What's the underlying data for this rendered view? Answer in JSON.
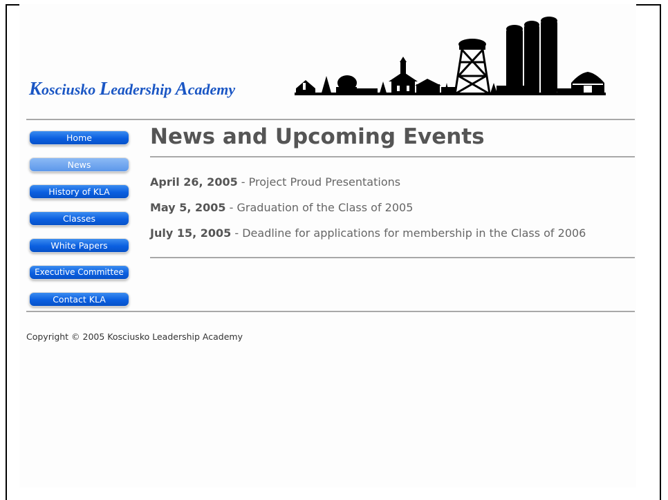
{
  "site": {
    "title_letters": [
      {
        "cap": "K",
        "rest": "osciusko "
      },
      {
        "cap": "L",
        "rest": "eadership "
      },
      {
        "cap": "A",
        "rest": "cademy"
      }
    ]
  },
  "nav": {
    "items": [
      {
        "label": "Home",
        "active": false
      },
      {
        "label": "News",
        "active": true
      },
      {
        "label": "History of KLA",
        "active": false
      },
      {
        "label": "Classes",
        "active": false
      },
      {
        "label": "White Papers",
        "active": false
      },
      {
        "label": "Executive Committee",
        "active": false
      },
      {
        "label": "Contact KLA",
        "active": false
      }
    ]
  },
  "main": {
    "title": "News and Upcoming Events",
    "events": [
      {
        "date": "April 26, 2005",
        "separator": " - ",
        "text": "Project Proud Presentations"
      },
      {
        "date": "May 5, 2005",
        "separator": " - ",
        "text": "Graduation of the Class of 2005"
      },
      {
        "date": "July 15, 2005",
        "separator": " - ",
        "text": "Deadline for applications for membership in the Class of 2006"
      }
    ]
  },
  "footer": {
    "copyright": "Copyright © 2005 Kosciusko Leadership Academy"
  },
  "colors": {
    "title_blue": "#1a56c4",
    "nav_blue": "#0b5fe0",
    "nav_active": "#5c97ea",
    "rule_gray": "#a8a8a8",
    "text_gray": "#666666"
  }
}
